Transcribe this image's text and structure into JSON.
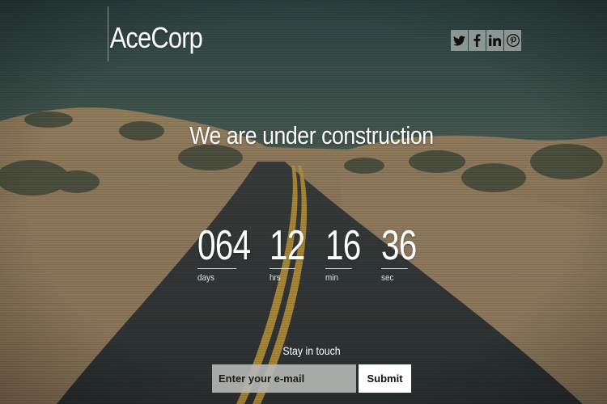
{
  "header": {
    "logo_text": "AceCorp",
    "social": [
      {
        "icon": "twitter-icon"
      },
      {
        "icon": "facebook-icon"
      },
      {
        "icon": "linkedin-icon"
      },
      {
        "icon": "pinterest-icon"
      }
    ]
  },
  "main": {
    "headline": "We are under construction",
    "countdown": [
      {
        "value": "064",
        "label": "days"
      },
      {
        "value": "12",
        "label": "hrs"
      },
      {
        "value": "16",
        "label": "min"
      },
      {
        "value": "36",
        "label": "sec"
      }
    ]
  },
  "subscribe": {
    "heading": "Stay in touch",
    "email_placeholder": "Enter your e-mail",
    "submit_label": "Submit"
  },
  "colors": {
    "overlay": "#2f3b3a",
    "sand": "#c9a778",
    "road": "#2d2f31",
    "stripe": "#d9a83a"
  }
}
